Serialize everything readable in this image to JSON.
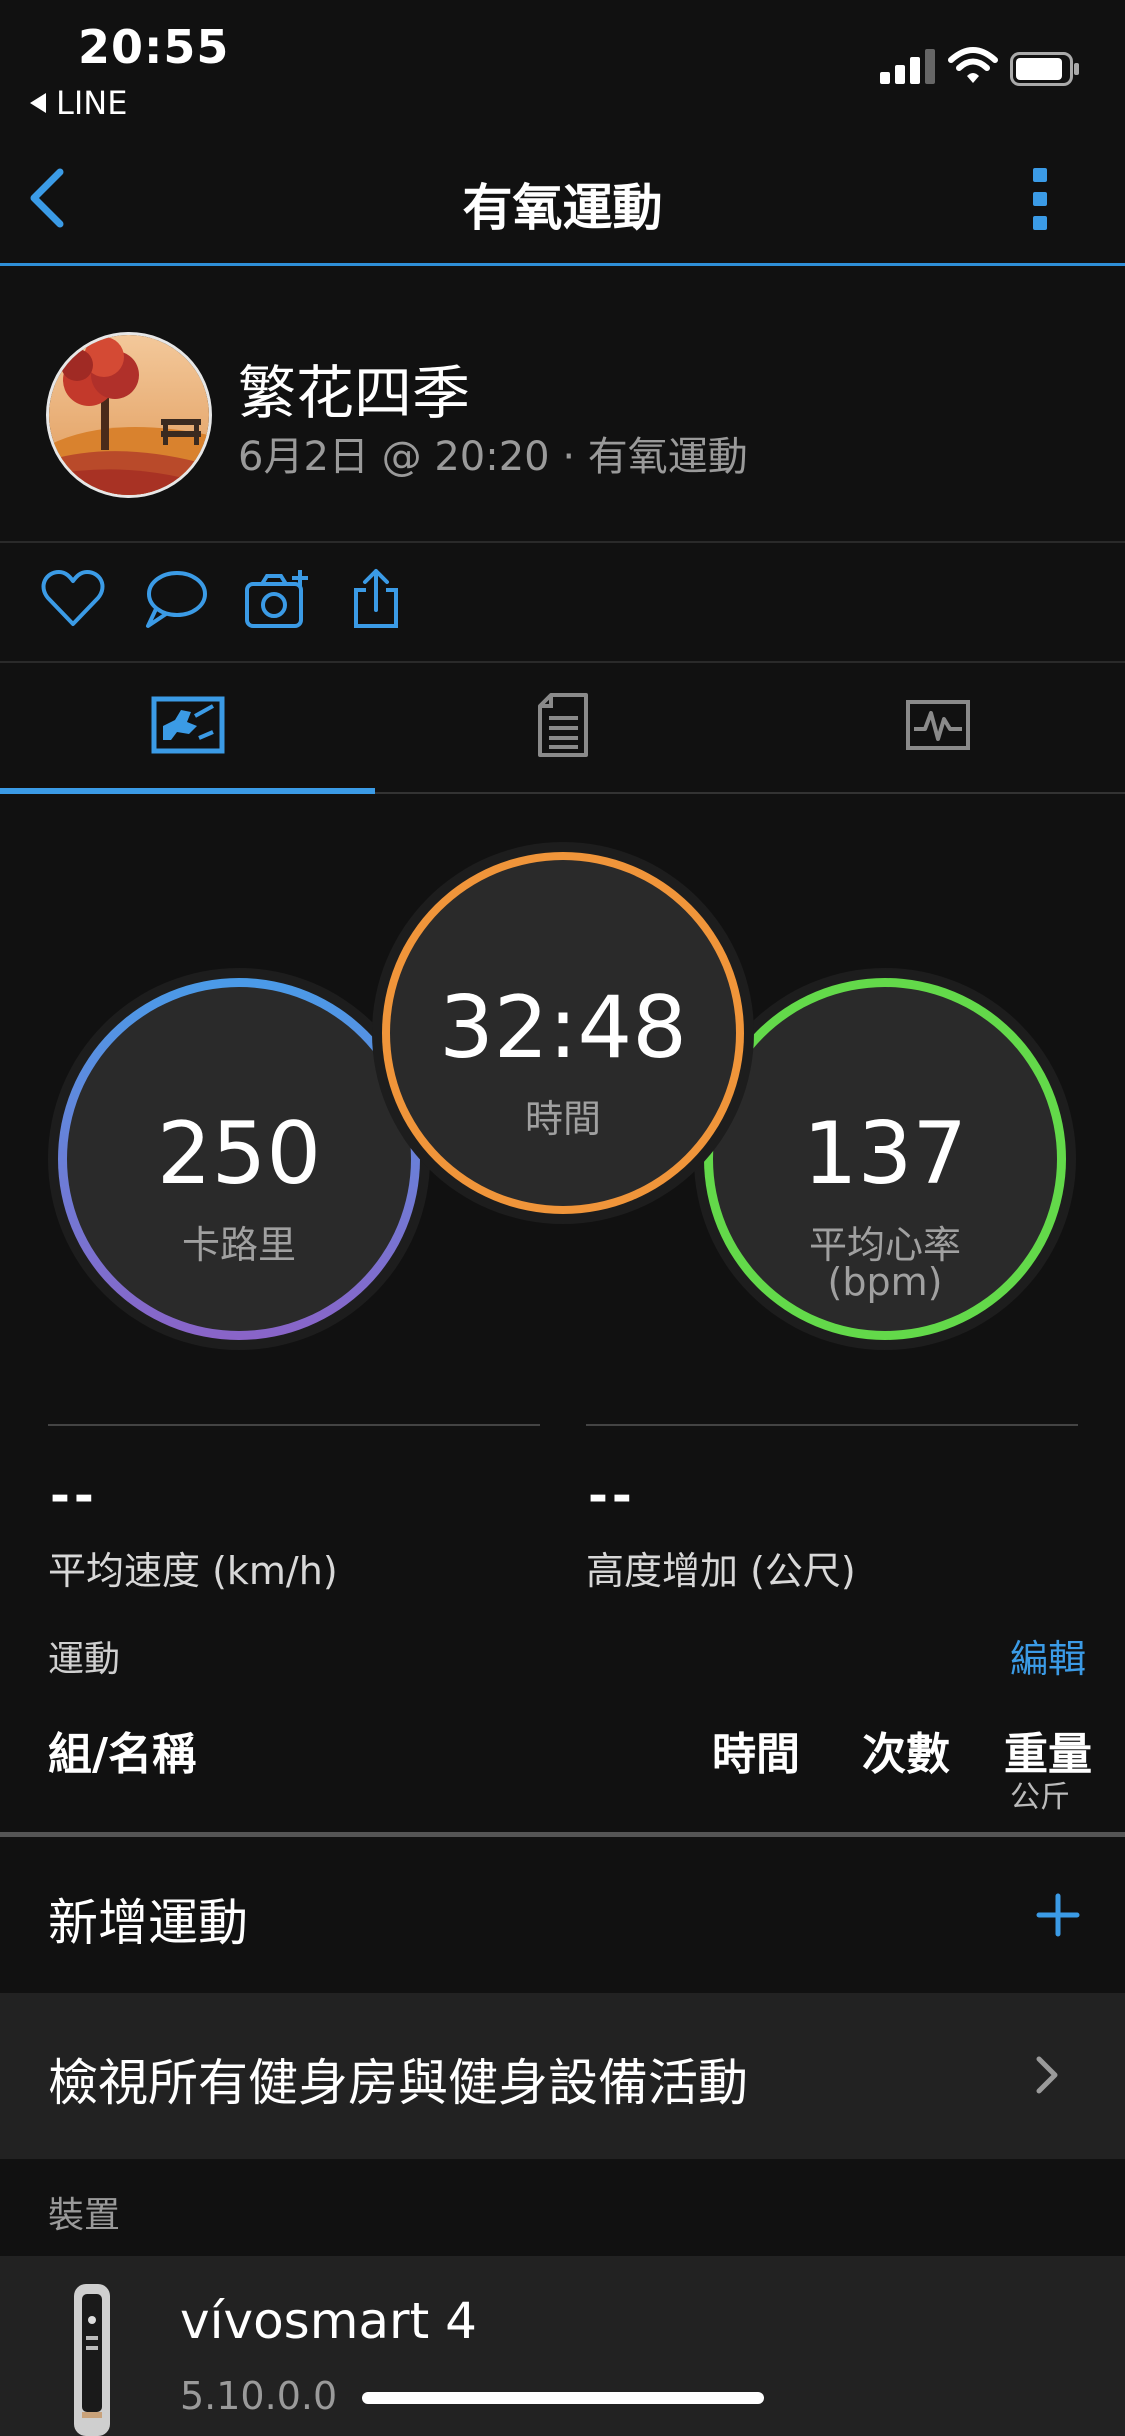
{
  "status_bar": {
    "time": "20:55",
    "back_app": "LINE"
  },
  "nav": {
    "title": "有氧運動",
    "back_icon": "chevron-left-icon",
    "more_icon": "more-vertical-icon"
  },
  "profile": {
    "name": "繁花四季",
    "meta": "6月2日 @ 20:20 · 有氧運動"
  },
  "actions": [
    "heart-icon",
    "comment-icon",
    "add-photo-icon",
    "share-icon"
  ],
  "tabs": [
    {
      "icon": "overview-icon",
      "active": true
    },
    {
      "icon": "details-icon",
      "active": false
    },
    {
      "icon": "chart-icon",
      "active": false
    }
  ],
  "rings": {
    "calories": {
      "value": "250",
      "label": "卡路里"
    },
    "time": {
      "value": "32:48",
      "label": "時間"
    },
    "heart_rate": {
      "value": "137",
      "label": "平均心率",
      "unit": "(bpm)"
    }
  },
  "stats": {
    "avg_speed": {
      "value": "--",
      "label": "平均速度 (km/h)"
    },
    "elevation_gain": {
      "value": "--",
      "label": "高度增加 (公尺)"
    }
  },
  "exercise": {
    "section_label": "運動",
    "edit_label": "編輯",
    "columns": {
      "set_name": "組/名稱",
      "time": "時間",
      "reps": "次數",
      "weight": "重量",
      "weight_unit": "公斤"
    }
  },
  "add_exercise": {
    "label": "新增運動",
    "icon": "plus-icon"
  },
  "view_all": {
    "label": "檢視所有健身房與健身設備活動",
    "icon": "chevron-right-icon"
  },
  "device": {
    "section_label": "裝置",
    "name": "vívosmart 4",
    "version": "5.10.0.0"
  },
  "colors": {
    "accent": "#3b9be6",
    "time_ring": "#f0953a",
    "calories_ring": [
      "#4a9be8",
      "#8a64c8"
    ],
    "heart_ring": "#63d94a"
  }
}
